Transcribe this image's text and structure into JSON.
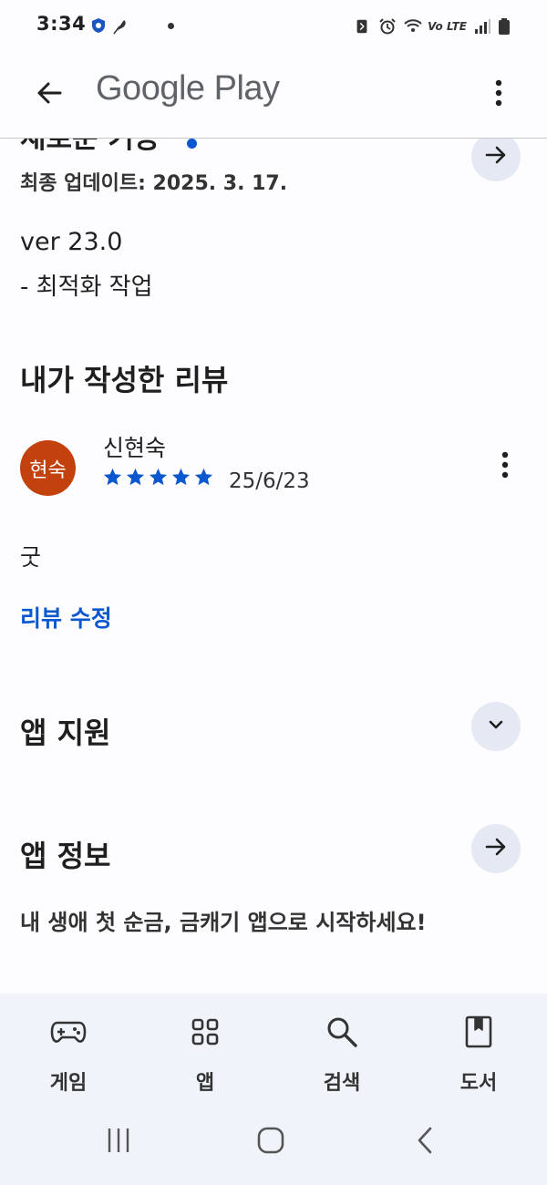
{
  "status_bar": {
    "time": "3:34",
    "network_label": "Vo LTE",
    "left_icons": [
      "shield-icon",
      "feather-icon"
    ],
    "right_icons": [
      "nfc-icon",
      "alarm-icon",
      "wifi-icon",
      "signal-icon",
      "battery-icon"
    ]
  },
  "app_bar": {
    "title": "Google Play",
    "back_icon": "arrow-left-icon",
    "menu_icon": "more-vert-icon"
  },
  "whats_new": {
    "title": "새로운 기능",
    "last_updated": "최종 업데이트: 2025. 3. 17.",
    "version": "ver 23.0",
    "notes": "- 최적화 작업"
  },
  "my_review": {
    "heading": "내가 작성한 리뷰",
    "avatar_text": "현숙",
    "avatar_color": "#c2410c",
    "reviewer_name": "신현숙",
    "rating": 5,
    "rating_max": 5,
    "date": "25/6/23",
    "body": "굿",
    "edit_label": "리뷰 수정"
  },
  "app_support": {
    "heading": "앱 지원"
  },
  "about_app": {
    "heading": "앱 정보",
    "description": "내 생애 첫 순금, 금캐기 앱으로 시작하세요!"
  },
  "bottom_nav": {
    "items": [
      {
        "label": "게임",
        "icon": "gamepad-icon"
      },
      {
        "label": "앱",
        "icon": "apps-grid-icon"
      },
      {
        "label": "검색",
        "icon": "search-icon"
      },
      {
        "label": "도서",
        "icon": "book-icon"
      }
    ]
  },
  "colors": {
    "accent": "#0b57d0",
    "button_bg": "#e5e9f3",
    "nav_bg": "#f0f3f9",
    "star": "#0b57d0"
  }
}
